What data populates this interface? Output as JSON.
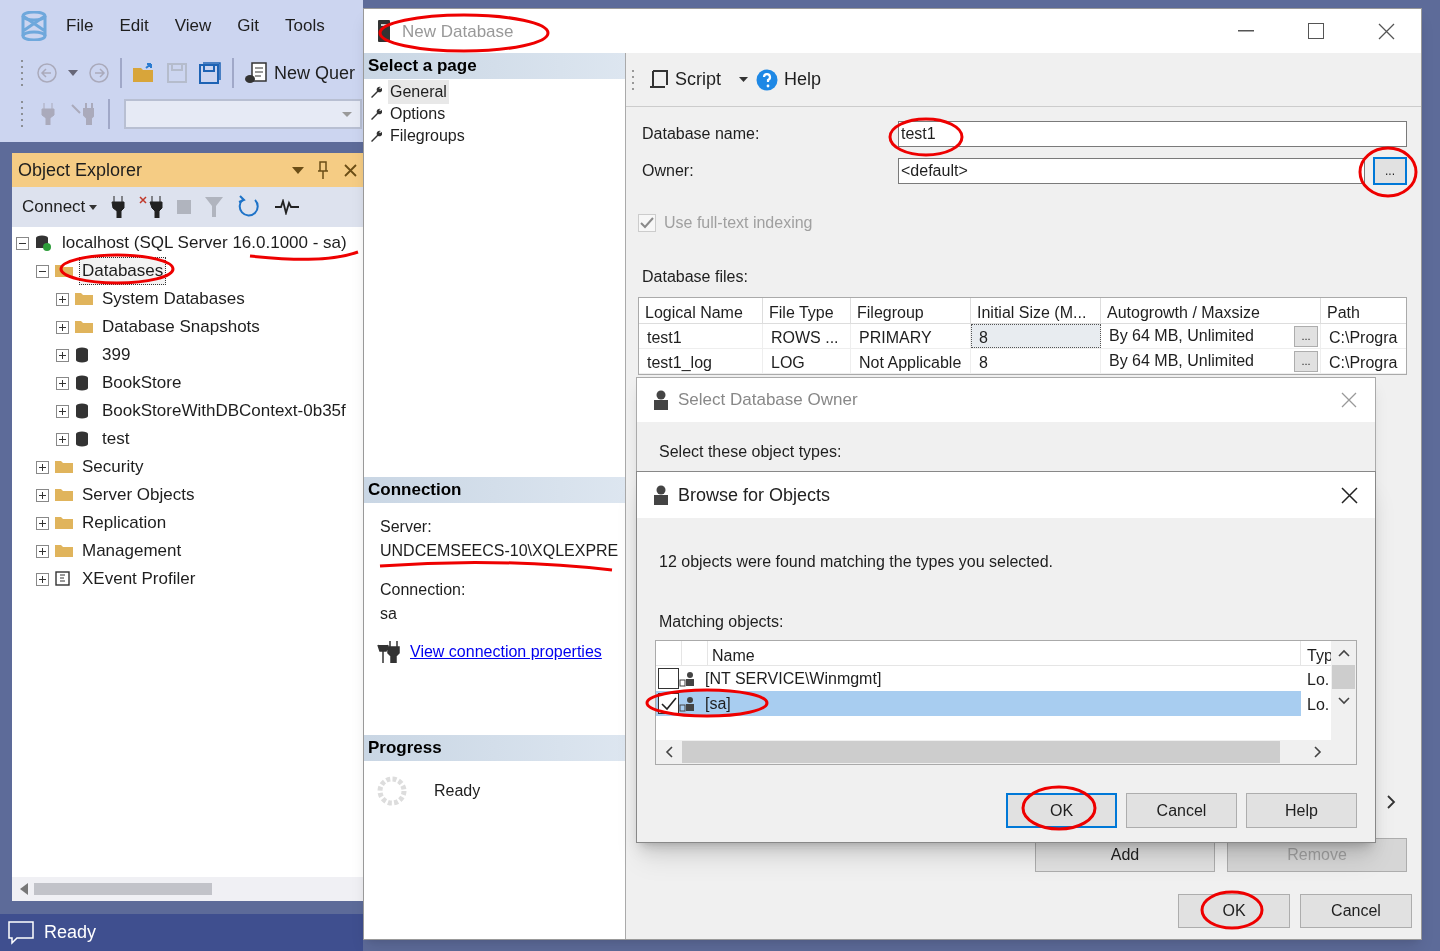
{
  "app": {
    "menu": [
      "File",
      "Edit",
      "View",
      "Git",
      "Tools"
    ],
    "new_query": "New Quer",
    "status": "Ready"
  },
  "object_explorer": {
    "title": "Object Explorer",
    "connect": "Connect",
    "tree": [
      {
        "label": "localhost (SQL Server 16.0.1000 - sa)",
        "kind": "server",
        "expanded": true,
        "selected": false,
        "children": [
          {
            "label": "Databases",
            "kind": "folder",
            "expanded": true,
            "selected": true,
            "children": [
              {
                "label": "System Databases",
                "kind": "folder",
                "expanded": false,
                "selected": false
              },
              {
                "label": "Database Snapshots",
                "kind": "folder",
                "expanded": false,
                "selected": false
              },
              {
                "label": "399",
                "kind": "database",
                "expanded": false,
                "selected": false
              },
              {
                "label": "BookStore",
                "kind": "database",
                "expanded": false,
                "selected": false
              },
              {
                "label": "BookStoreWithDBContext-0b35f",
                "kind": "database",
                "expanded": false,
                "selected": false
              },
              {
                "label": "test",
                "kind": "database",
                "expanded": false,
                "selected": false
              }
            ]
          },
          {
            "label": "Security",
            "kind": "folder",
            "expanded": false,
            "selected": false
          },
          {
            "label": "Server Objects",
            "kind": "folder",
            "expanded": false,
            "selected": false
          },
          {
            "label": "Replication",
            "kind": "folder",
            "expanded": false,
            "selected": false
          },
          {
            "label": "Management",
            "kind": "folder",
            "expanded": false,
            "selected": false
          },
          {
            "label": "XEvent Profiler",
            "kind": "xevent",
            "expanded": false,
            "selected": false
          }
        ]
      }
    ]
  },
  "new_database": {
    "title": "New Database",
    "select_page": "Select a page",
    "pages": [
      {
        "label": "General",
        "selected": true
      },
      {
        "label": "Options",
        "selected": false
      },
      {
        "label": "Filegroups",
        "selected": false
      }
    ],
    "toolbar": {
      "script": "Script",
      "help": "Help"
    },
    "database_name": {
      "label": "Database name:",
      "value": "test1"
    },
    "owner": {
      "label": "Owner:",
      "value": "<default>",
      "button": "..."
    },
    "full_text": {
      "label": "Use full-text indexing",
      "checked": true,
      "disabled": true
    },
    "files_label": "Database files:",
    "files": {
      "columns": [
        "Logical Name",
        "File Type",
        "Filegroup",
        "Initial Size (M...",
        "Autogrowth / Maxsize",
        "Path"
      ],
      "rows": [
        {
          "logical_name": "test1",
          "file_type": "ROWS ...",
          "filegroup": "PRIMARY",
          "initial_size": "8",
          "autogrowth": "By 64 MB, Unlimited",
          "button": "...",
          "path": "C:\\Progra",
          "selected": true
        },
        {
          "logical_name": "test1_log",
          "file_type": "LOG",
          "filegroup": "Not Applicable",
          "initial_size": "8",
          "autogrowth": "By 64 MB, Unlimited",
          "button": "...",
          "path": "C:\\Progra",
          "selected": false
        }
      ]
    },
    "connection": {
      "title": "Connection",
      "server_label": "Server:",
      "server": "UNDCEMSEECS-10\\XQLEXPRE",
      "connection_label": "Connection:",
      "connection": "sa",
      "link": "View connection properties"
    },
    "progress": {
      "title": "Progress",
      "status": "Ready"
    },
    "buttons": [
      {
        "label": "Add",
        "disabled": false
      },
      {
        "label": "Remove",
        "disabled": true
      }
    ],
    "footer_buttons": [
      "OK",
      "Cancel"
    ]
  },
  "select_owner": {
    "title": "Select Database Owner",
    "object_types_label": "Select these object types:"
  },
  "browse": {
    "title": "Browse for Objects",
    "message": "12 objects were found matching the types you selected.",
    "matching_label": "Matching objects:",
    "columns": [
      "Name",
      "Typ"
    ],
    "rows": [
      {
        "name": "[NT SERVICE\\Winmgmt]",
        "type": "Lo.",
        "checked": false,
        "selected": false
      },
      {
        "name": "[sa]",
        "type": "Lo.",
        "checked": true,
        "selected": true
      }
    ],
    "buttons": [
      {
        "label": "OK",
        "default": true
      },
      {
        "label": "Cancel",
        "default": false
      },
      {
        "label": "Help",
        "default": false
      }
    ]
  }
}
